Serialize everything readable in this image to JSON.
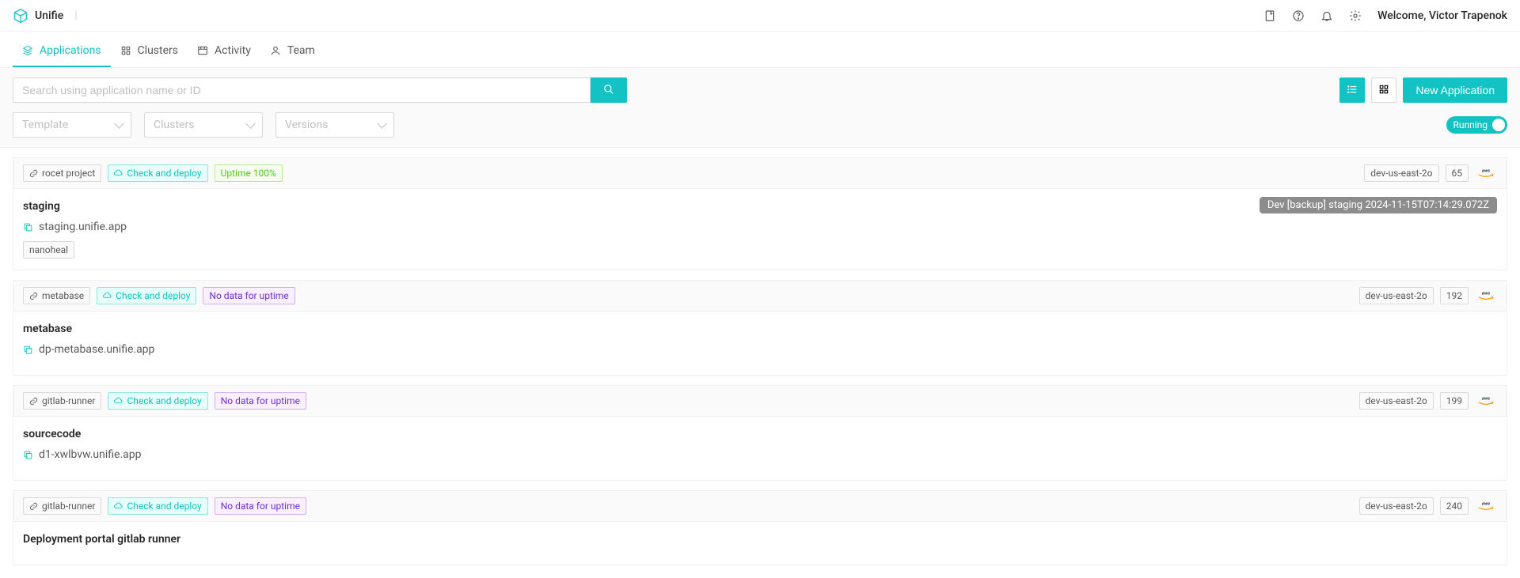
{
  "brand": "Unifie",
  "header": {
    "welcome": "Welcome, Victor Trapenok"
  },
  "nav": {
    "applications": "Applications",
    "clusters": "Clusters",
    "activity": "Activity",
    "team": "Team"
  },
  "filters": {
    "search_placeholder": "Search using application name or ID",
    "template": "Template",
    "clusters": "Clusters",
    "versions": "Versions",
    "running_label": "Running",
    "new_app": "New Application"
  },
  "apps": [
    {
      "project": "rocet project",
      "check_deploy": "Check and deploy",
      "uptime": "Uptime 100%",
      "uptime_style": "green",
      "region": "dev-us-east-2o",
      "count": "65",
      "title": "staging",
      "url": "staging.unifie.app",
      "backup": "Dev [backup] staging 2024-11-15T07:14:29.072Z",
      "subtags": [
        "nanoheal"
      ]
    },
    {
      "project": "metabase",
      "check_deploy": "Check and deploy",
      "uptime": "No data for uptime",
      "uptime_style": "purple",
      "region": "dev-us-east-2o",
      "count": "192",
      "title": "metabase",
      "url": "dp-metabase.unifie.app",
      "backup": "",
      "subtags": []
    },
    {
      "project": "gitlab-runner",
      "check_deploy": "Check and deploy",
      "uptime": "No data for uptime",
      "uptime_style": "purple",
      "region": "dev-us-east-2o",
      "count": "199",
      "title": "sourcecode",
      "url": "d1-xwlbvw.unifie.app",
      "backup": "",
      "subtags": []
    },
    {
      "project": "gitlab-runner",
      "check_deploy": "Check and deploy",
      "uptime": "No data for uptime",
      "uptime_style": "purple",
      "region": "dev-us-east-2o",
      "count": "240",
      "title": "Deployment portal gitlab runner",
      "url": "",
      "backup": "",
      "subtags": []
    }
  ]
}
